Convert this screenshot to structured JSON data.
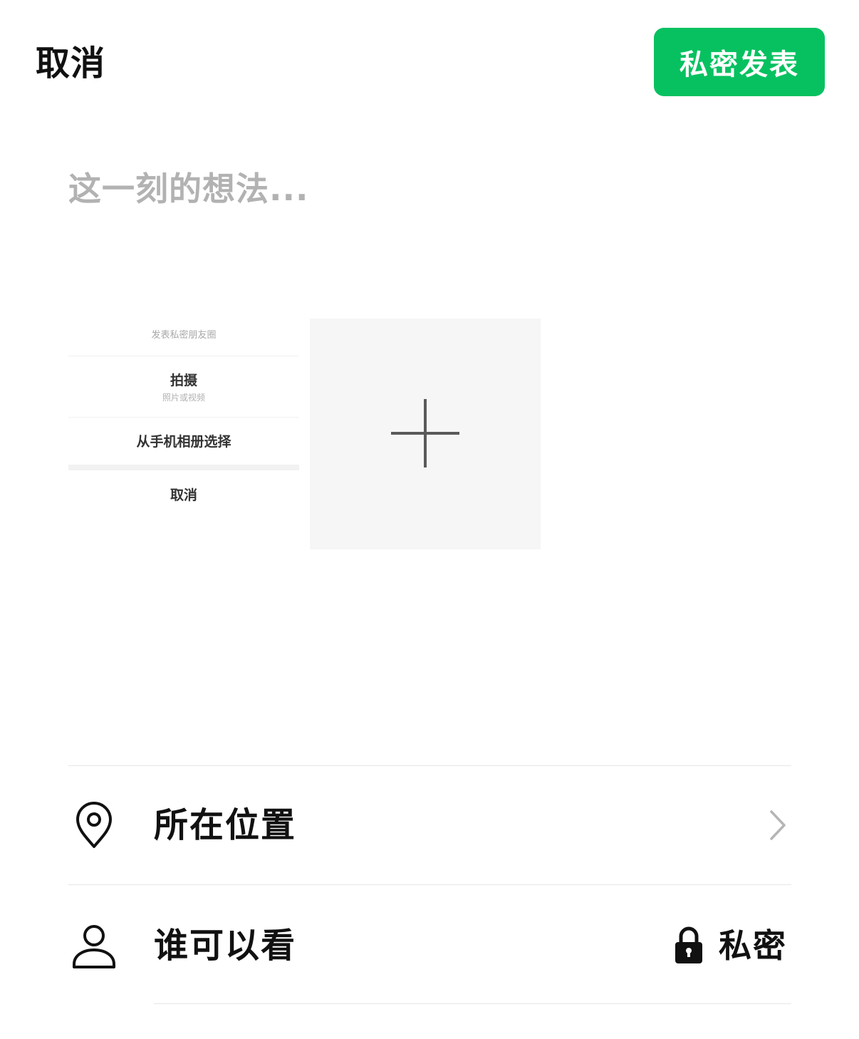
{
  "header": {
    "cancel_label": "取消",
    "publish_label": "私密发表"
  },
  "composer": {
    "placeholder": "这一刻的想法..."
  },
  "media": {
    "thumbnail": {
      "sheet_title": "发表私密朋友圈",
      "option_capture": "拍摄",
      "option_capture_sub": "照片或视频",
      "option_album": "从手机相册选择",
      "option_cancel": "取消"
    }
  },
  "settings": {
    "location": {
      "label": "所在位置",
      "icon": "location-pin-icon"
    },
    "visibility": {
      "label": "谁可以看",
      "icon": "person-icon",
      "value_icon": "lock-icon",
      "value": "私密"
    }
  },
  "colors": {
    "accent": "#07c160",
    "placeholder": "#b2b2b2",
    "tile_bg": "#f6f6f6"
  }
}
